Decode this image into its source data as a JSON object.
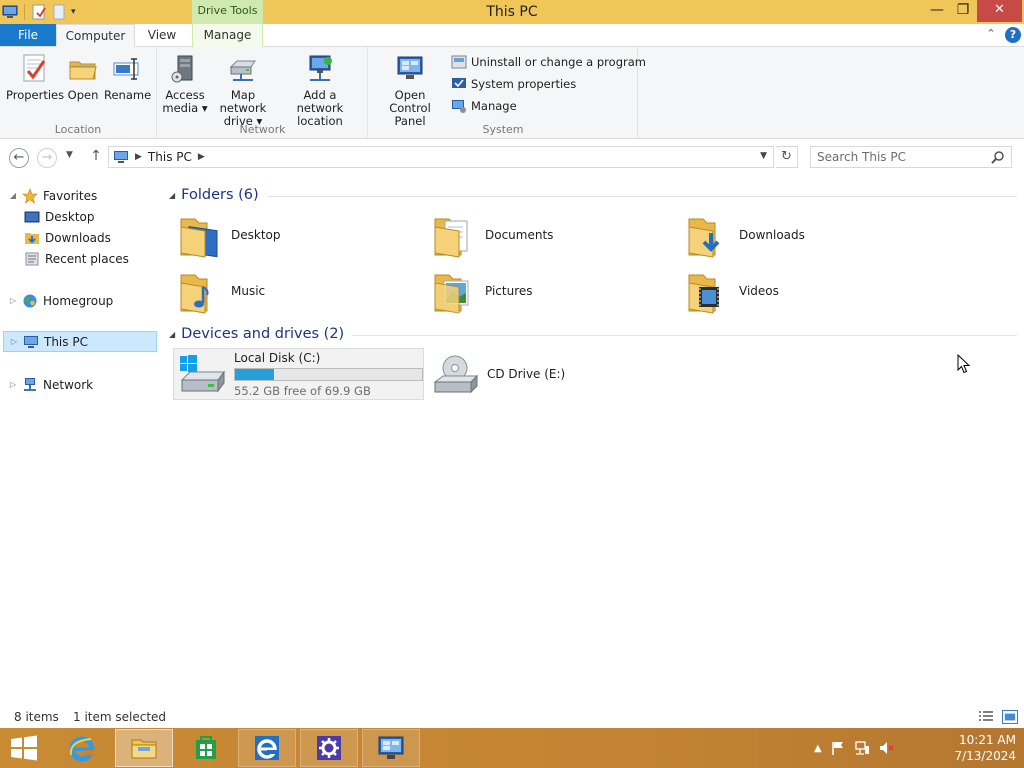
{
  "window": {
    "title": "This PC",
    "contextual_tab": "Drive Tools",
    "minimize": "—",
    "maximize": "❐",
    "close": "✕"
  },
  "ribbon_tabs": {
    "file": "File",
    "computer": "Computer",
    "view": "View",
    "manage": "Manage"
  },
  "ribbon": {
    "groups": [
      {
        "label": "Location"
      },
      {
        "label": "Network"
      },
      {
        "label": "System"
      }
    ],
    "location": {
      "properties": "Properties",
      "open": "Open",
      "rename": "Rename"
    },
    "network": {
      "access_media_1": "Access",
      "access_media_2": "media ▾",
      "map_drive_1": "Map network",
      "map_drive_2": "drive ▾",
      "add_location_1": "Add a network",
      "add_location_2": "location"
    },
    "system": {
      "control_panel_1": "Open Control",
      "control_panel_2": "Panel",
      "uninstall": "Uninstall or change a program",
      "system_properties": "System properties",
      "manage": "Manage"
    }
  },
  "address": {
    "path": "This PC",
    "search_placeholder": "Search This PC"
  },
  "nav_pane": {
    "favorites": "Favorites",
    "desktop": "Desktop",
    "downloads": "Downloads",
    "recent": "Recent places",
    "homegroup": "Homegroup",
    "this_pc": "This PC",
    "network": "Network"
  },
  "content": {
    "folders_header": "Folders (6)",
    "folders": [
      {
        "label": "Desktop"
      },
      {
        "label": "Documents"
      },
      {
        "label": "Downloads"
      },
      {
        "label": "Music"
      },
      {
        "label": "Pictures"
      },
      {
        "label": "Videos"
      }
    ],
    "drives_header": "Devices and drives (2)",
    "drives": [
      {
        "label": "Local Disk (C:)",
        "free_text": "55.2 GB free of 69.9 GB",
        "used_fraction": 0.21
      },
      {
        "label": "CD Drive (E:)"
      }
    ]
  },
  "status": {
    "item_count": "8 items",
    "selection": "1 item selected"
  },
  "taskbar": {
    "time": "10:21 AM",
    "date": "7/13/2024"
  },
  "colors": {
    "titlebar": "#f0c658",
    "file_tab": "#1979ca",
    "close_button": "#c74a47",
    "group_header_text": "#1e3287",
    "drive_bar_fill": "#26a0da",
    "taskbar": "#c48433"
  }
}
